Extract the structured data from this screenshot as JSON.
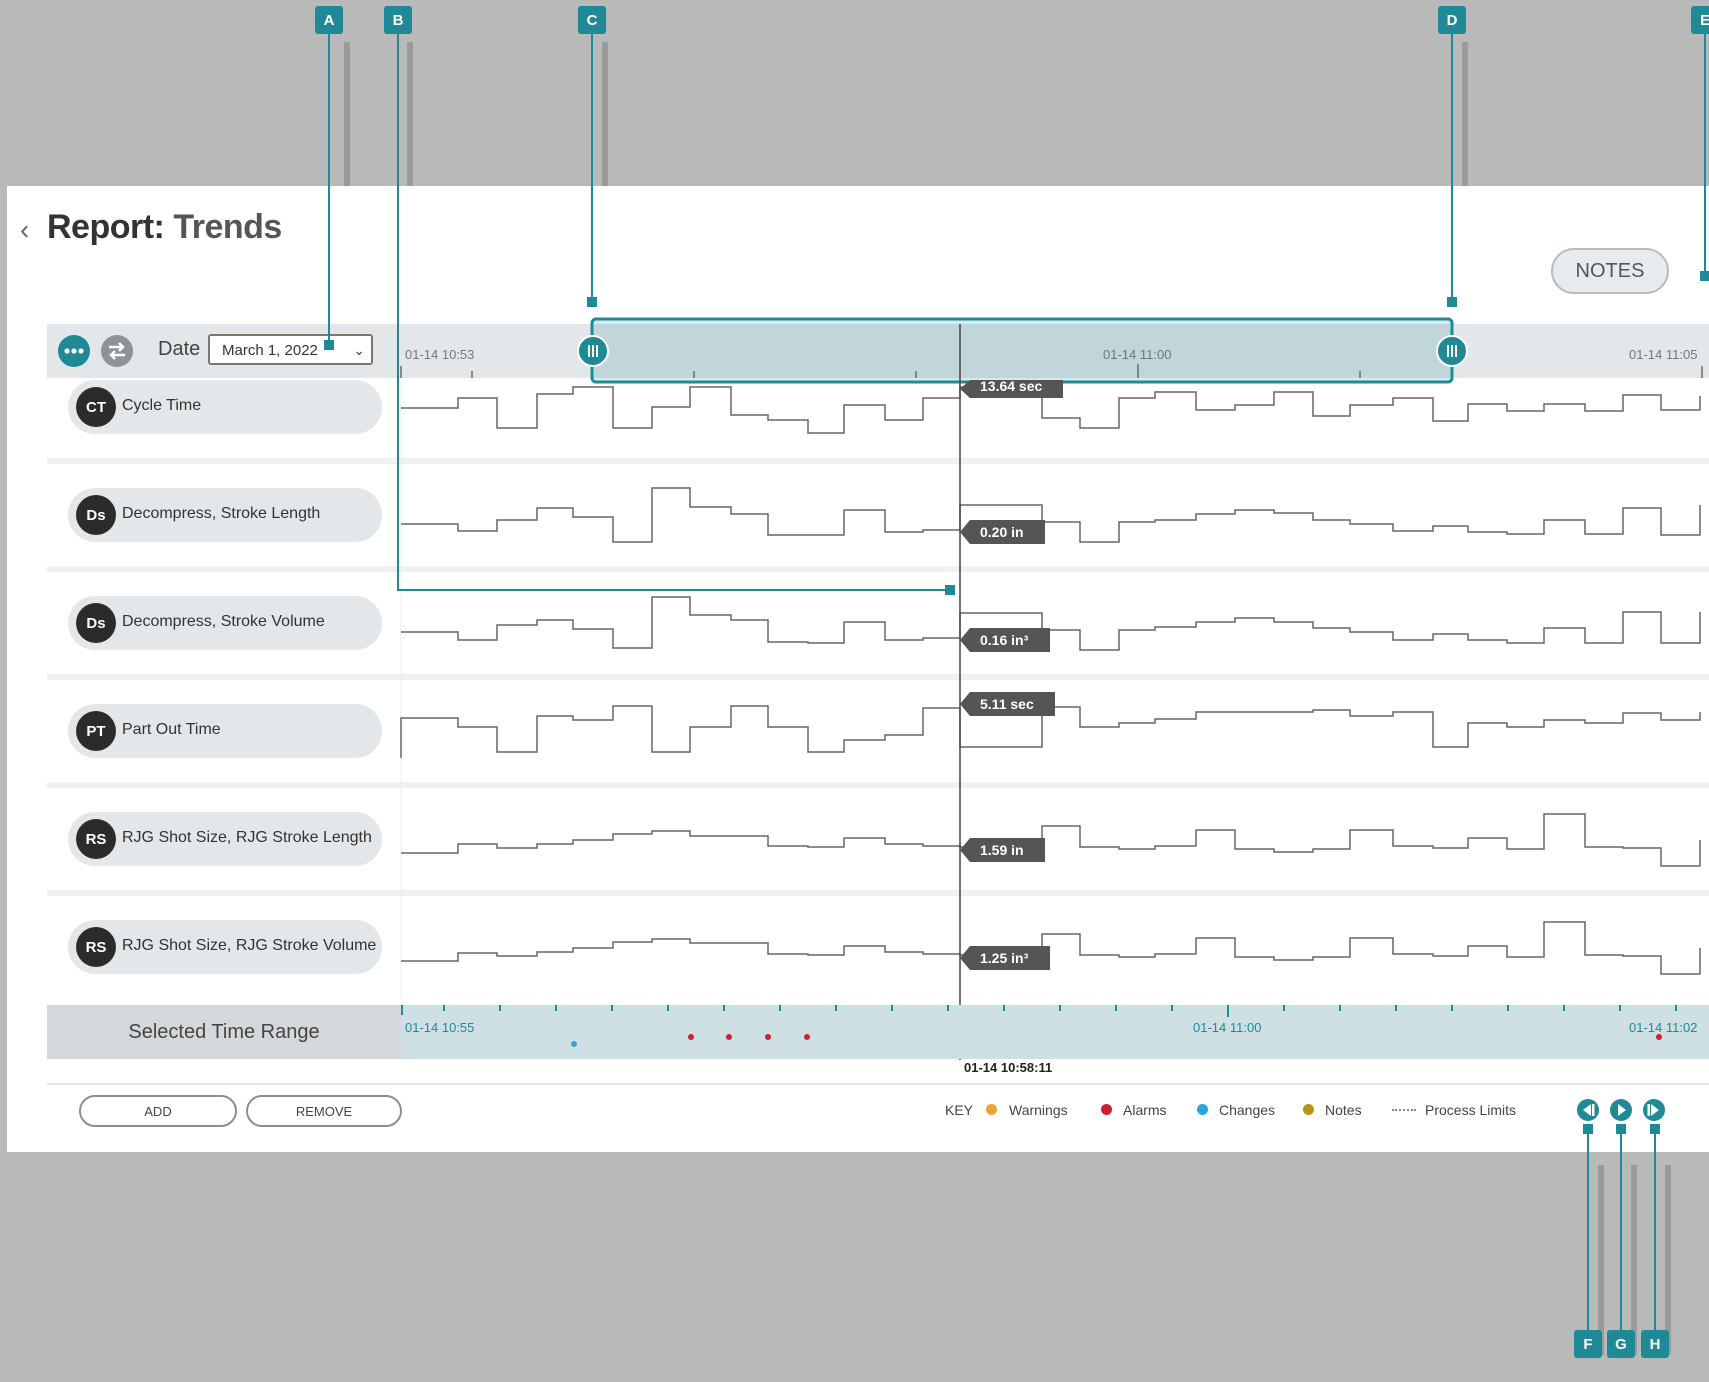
{
  "header": {
    "back_icon": "chevron-left-icon",
    "title_prefix": "Report:",
    "title_name": "Trends",
    "notes_label": "NOTES"
  },
  "toolbar": {
    "date_label": "Date",
    "date_value": "March 1, 2022"
  },
  "timeline": {
    "top_ticks": [
      "01-14 10:53",
      "01-14 11:00",
      "01-14 11:05"
    ],
    "bottom_ticks": [
      "01-14 10:55",
      "01-14 11:00",
      "01-14 11:02"
    ],
    "cursor_time": "01-14 10:58:11"
  },
  "rows": [
    {
      "abbr": "CT",
      "label": "Cycle Time",
      "value": "13.64 sec"
    },
    {
      "abbr": "Ds",
      "label": "Decompress, Stroke Length",
      "value": "0.20 in"
    },
    {
      "abbr": "Ds",
      "label": "Decompress, Stroke Volume",
      "value": "0.16 in³"
    },
    {
      "abbr": "PT",
      "label": "Part Out Time",
      "value": "5.11 sec"
    },
    {
      "abbr": "RS",
      "label": "RJG Shot Size, RJG Stroke Length",
      "value": "1.59 in"
    },
    {
      "abbr": "RS",
      "label": "RJG Shot Size, RJG Stroke Volume",
      "value": "1.25 in³"
    }
  ],
  "selected_range_label": "Selected Time Range",
  "footer": {
    "add_label": "ADD",
    "remove_label": "REMOVE",
    "key_label": "KEY",
    "warnings": "Warnings",
    "alarms": "Alarms",
    "changes": "Changes",
    "notes": "Notes",
    "limits": "Process Limits"
  },
  "callouts": [
    "A",
    "B",
    "C",
    "D",
    "E",
    "F",
    "G",
    "H"
  ],
  "colors": {
    "accent": "#1f8a96",
    "warning": "#f0a22e",
    "alarm": "#d0202f",
    "change": "#2aa5e0",
    "note": "#b8941a"
  }
}
